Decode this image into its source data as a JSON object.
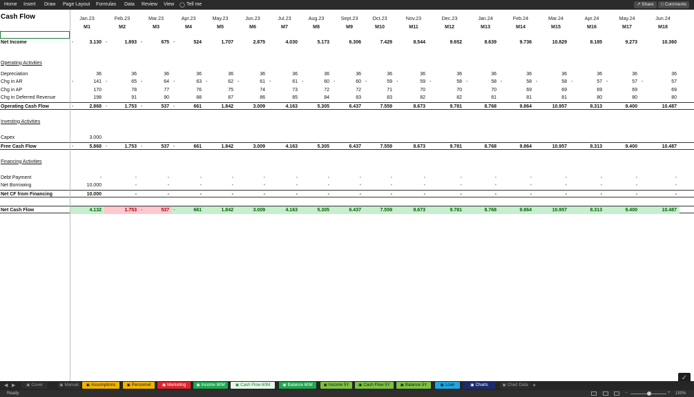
{
  "menubar": {
    "items": [
      "Home",
      "Insert",
      "Draw",
      "Page Layout",
      "Formulas",
      "Data",
      "Review",
      "View"
    ],
    "tell_me": "Tell me",
    "share": "Share",
    "comments": "Comments"
  },
  "sheet": {
    "title": "Cash Flow",
    "months": [
      "Jan.23",
      "Feb.23",
      "Mar.23",
      "Apr.23",
      "May.23",
      "Jun.23",
      "Jul.23",
      "Aug.23",
      "Sept.23",
      "Oct.23",
      "Nov.23",
      "Dec.23",
      "Jan.24",
      "Feb.24",
      "Mar.24",
      "Apr.24",
      "May.24",
      "Jun.24"
    ],
    "periods": [
      "M1",
      "M2",
      "M3",
      "M4",
      "M5",
      "M6",
      "M7",
      "M8",
      "M9",
      "M10",
      "M11",
      "M12",
      "M13",
      "M14",
      "M15",
      "M16",
      "M17",
      "M18"
    ],
    "rows": [
      {
        "label": "Net Income",
        "style": "bold",
        "lead_dash": "-",
        "cells": [
          {
            "v": "3.130",
            "n": true
          },
          {
            "v": "1.893",
            "n": true
          },
          {
            "v": "675",
            "n": true
          },
          {
            "v": "524"
          },
          {
            "v": "1.707"
          },
          {
            "v": "2.875"
          },
          {
            "v": "4.030"
          },
          {
            "v": "5.173"
          },
          {
            "v": "6.306"
          },
          {
            "v": "7.429"
          },
          {
            "v": "8.544"
          },
          {
            "v": "9.652"
          },
          {
            "v": "8.639"
          },
          {
            "v": "9.736"
          },
          {
            "v": "10.829"
          },
          {
            "v": "8.185"
          },
          {
            "v": "9.273"
          },
          {
            "v": "10.360"
          }
        ]
      },
      {
        "label": "Operating Activities",
        "style": "section",
        "cells": []
      },
      {
        "label": "Depreciation",
        "style": "",
        "cells": [
          {
            "v": "36"
          },
          {
            "v": "36"
          },
          {
            "v": "36"
          },
          {
            "v": "36"
          },
          {
            "v": "36"
          },
          {
            "v": "36"
          },
          {
            "v": "36"
          },
          {
            "v": "36"
          },
          {
            "v": "36"
          },
          {
            "v": "36"
          },
          {
            "v": "36"
          },
          {
            "v": "36"
          },
          {
            "v": "36"
          },
          {
            "v": "36"
          },
          {
            "v": "36"
          },
          {
            "v": "36"
          },
          {
            "v": "36"
          },
          {
            "v": "36"
          }
        ]
      },
      {
        "label": "Chg in AR",
        "style": "",
        "lead_dash": "-",
        "cells": [
          {
            "v": "141",
            "n": true
          },
          {
            "v": "65",
            "n": true
          },
          {
            "v": "64",
            "n": true
          },
          {
            "v": "63",
            "n": true
          },
          {
            "v": "62",
            "n": true
          },
          {
            "v": "61",
            "n": true
          },
          {
            "v": "61",
            "n": true
          },
          {
            "v": "60",
            "n": true
          },
          {
            "v": "60",
            "n": true
          },
          {
            "v": "59",
            "n": true
          },
          {
            "v": "59",
            "n": true
          },
          {
            "v": "58",
            "n": true
          },
          {
            "v": "58",
            "n": true
          },
          {
            "v": "58",
            "n": true
          },
          {
            "v": "58",
            "n": true
          },
          {
            "v": "57",
            "n": true
          },
          {
            "v": "57",
            "n": true
          },
          {
            "v": "57"
          }
        ]
      },
      {
        "label": "Chg in AP",
        "style": "",
        "cells": [
          {
            "v": "170"
          },
          {
            "v": "78"
          },
          {
            "v": "77"
          },
          {
            "v": "76"
          },
          {
            "v": "75"
          },
          {
            "v": "74"
          },
          {
            "v": "73"
          },
          {
            "v": "72"
          },
          {
            "v": "72"
          },
          {
            "v": "71"
          },
          {
            "v": "70"
          },
          {
            "v": "70"
          },
          {
            "v": "70"
          },
          {
            "v": "69"
          },
          {
            "v": "69"
          },
          {
            "v": "69"
          },
          {
            "v": "69"
          },
          {
            "v": "69"
          }
        ]
      },
      {
        "label": "Chg in Deferred Revenue",
        "style": "",
        "cells": [
          {
            "v": "198"
          },
          {
            "v": "91"
          },
          {
            "v": "90"
          },
          {
            "v": "88"
          },
          {
            "v": "87"
          },
          {
            "v": "86"
          },
          {
            "v": "85"
          },
          {
            "v": "84"
          },
          {
            "v": "83"
          },
          {
            "v": "83"
          },
          {
            "v": "82"
          },
          {
            "v": "82"
          },
          {
            "v": "81"
          },
          {
            "v": "81"
          },
          {
            "v": "81"
          },
          {
            "v": "80"
          },
          {
            "v": "80"
          },
          {
            "v": "80"
          }
        ]
      },
      {
        "label": "Operating Cash Flow",
        "style": "bold-border",
        "lead_dash": "-",
        "cells": [
          {
            "v": "2.868",
            "n": true
          },
          {
            "v": "1.753",
            "n": true
          },
          {
            "v": "537",
            "n": true
          },
          {
            "v": "661"
          },
          {
            "v": "1.842"
          },
          {
            "v": "3.009"
          },
          {
            "v": "4.163"
          },
          {
            "v": "5.305"
          },
          {
            "v": "6.437"
          },
          {
            "v": "7.559"
          },
          {
            "v": "8.673"
          },
          {
            "v": "9.781"
          },
          {
            "v": "8.768"
          },
          {
            "v": "9.864"
          },
          {
            "v": "10.957"
          },
          {
            "v": "8.313"
          },
          {
            "v": "9.400"
          },
          {
            "v": "10.487"
          }
        ]
      },
      {
        "label": "Investing Activities",
        "style": "section",
        "cells": []
      },
      {
        "label": "Capex",
        "style": "",
        "cells": [
          {
            "v": "3.000"
          }
        ]
      },
      {
        "label": "Free Cash Flow",
        "style": "bold-border",
        "lead_dash": "-",
        "cells": [
          {
            "v": "5.868",
            "n": true
          },
          {
            "v": "1.753",
            "n": true
          },
          {
            "v": "537",
            "n": true
          },
          {
            "v": "661"
          },
          {
            "v": "1.842"
          },
          {
            "v": "3.009"
          },
          {
            "v": "4.163"
          },
          {
            "v": "5.305"
          },
          {
            "v": "6.437"
          },
          {
            "v": "7.559"
          },
          {
            "v": "8.673"
          },
          {
            "v": "9.781"
          },
          {
            "v": "8.768"
          },
          {
            "v": "9.864"
          },
          {
            "v": "10.957"
          },
          {
            "v": "8.313"
          },
          {
            "v": "9.400"
          },
          {
            "v": "10.487"
          }
        ]
      },
      {
        "label": "Financing Activities",
        "style": "section",
        "cells": []
      },
      {
        "label": "Debt Payment",
        "style": "",
        "cells": [
          {
            "v": "-"
          },
          {
            "v": "-"
          },
          {
            "v": "-"
          },
          {
            "v": "-"
          },
          {
            "v": "-"
          },
          {
            "v": "-"
          },
          {
            "v": "-"
          },
          {
            "v": "-"
          },
          {
            "v": "-"
          },
          {
            "v": "-"
          },
          {
            "v": "-"
          },
          {
            "v": "-"
          },
          {
            "v": "-"
          },
          {
            "v": "-"
          },
          {
            "v": "-"
          },
          {
            "v": "-"
          },
          {
            "v": "-"
          },
          {
            "v": "-"
          }
        ]
      },
      {
        "label": "Net Borrowing",
        "style": "",
        "cells": [
          {
            "v": "10.000"
          },
          {
            "v": "-"
          },
          {
            "v": "-"
          },
          {
            "v": "-"
          },
          {
            "v": "-"
          },
          {
            "v": "-"
          },
          {
            "v": "-"
          },
          {
            "v": "-"
          },
          {
            "v": "-"
          },
          {
            "v": "-"
          },
          {
            "v": "-"
          },
          {
            "v": "-"
          },
          {
            "v": "-"
          },
          {
            "v": "-"
          },
          {
            "v": "-"
          },
          {
            "v": "-"
          },
          {
            "v": "-"
          },
          {
            "v": "-"
          }
        ]
      },
      {
        "label": "Net CF from Financing",
        "style": "bold-border",
        "cells": [
          {
            "v": "10.000"
          },
          {
            "v": "-"
          },
          {
            "v": "-"
          },
          {
            "v": "-"
          },
          {
            "v": "-"
          },
          {
            "v": "-"
          },
          {
            "v": "-"
          },
          {
            "v": "-"
          },
          {
            "v": "-"
          },
          {
            "v": "-"
          },
          {
            "v": "-"
          },
          {
            "v": "-"
          },
          {
            "v": "-"
          },
          {
            "v": "-"
          },
          {
            "v": "-"
          },
          {
            "v": "-"
          },
          {
            "v": "-"
          },
          {
            "v": "-"
          }
        ]
      },
      {
        "label": "Net Cash Flow",
        "style": "bold-border",
        "cells": [
          {
            "v": "4.132",
            "bg": "pos"
          },
          {
            "v": "1.753",
            "n": true,
            "bg": "neg"
          },
          {
            "v": "537",
            "n": true,
            "bg": "neg"
          },
          {
            "v": "661",
            "bg": "pos"
          },
          {
            "v": "1.842",
            "bg": "pos"
          },
          {
            "v": "3.009",
            "bg": "pos"
          },
          {
            "v": "4.163",
            "bg": "pos"
          },
          {
            "v": "5.305",
            "bg": "pos"
          },
          {
            "v": "6.437",
            "bg": "pos"
          },
          {
            "v": "7.559",
            "bg": "pos"
          },
          {
            "v": "8.673",
            "bg": "pos"
          },
          {
            "v": "9.781",
            "bg": "pos"
          },
          {
            "v": "8.768",
            "bg": "pos"
          },
          {
            "v": "9.864",
            "bg": "pos"
          },
          {
            "v": "10.957",
            "bg": "pos"
          },
          {
            "v": "8.313",
            "bg": "pos"
          },
          {
            "v": "9.400",
            "bg": "pos"
          },
          {
            "v": "10.487",
            "bg": "pos"
          }
        ]
      }
    ]
  },
  "colors": {
    "positive_fill": "#c6efce",
    "positive_text": "#006100",
    "negative_fill": "#ffc7ce",
    "negative_text": "#9c0006"
  },
  "tabs": [
    {
      "label": "Cover",
      "bg": "#2e2e2e",
      "fg": "#9a9a9a",
      "lock": true
    },
    {
      "label": "Manual",
      "bg": "#2e2e2e",
      "fg": "#9a9a9a",
      "lock": true
    },
    {
      "label": "Assumptions",
      "bg": "#f0b400",
      "fg": "#1a1a1a",
      "lock": true
    },
    {
      "label": "Personnel",
      "bg": "#f0b400",
      "fg": "#1a1a1a",
      "lock": true
    },
    {
      "label": "Marketing",
      "bg": "#e0242b",
      "fg": "#ffffff",
      "lock": true
    },
    {
      "label": "Income 60M",
      "bg": "#1fa84f",
      "fg": "#ffffff",
      "lock": true
    },
    {
      "label": "Cash Flow 60M",
      "bg": "#e8f5e9",
      "fg": "#1b7a3d",
      "lock": true,
      "active": true
    },
    {
      "label": "Balance 60M",
      "bg": "#1fa84f",
      "fg": "#ffffff",
      "lock": true
    },
    {
      "label": "Income 5Y",
      "bg": "#7cc242",
      "fg": "#1a1a1a",
      "lock": true
    },
    {
      "label": "Cash Flow 5Y",
      "bg": "#7cc242",
      "fg": "#1a1a1a",
      "lock": true
    },
    {
      "label": "Balance 5Y",
      "bg": "#7cc242",
      "fg": "#1a1a1a",
      "lock": true
    },
    {
      "label": "Loan",
      "bg": "#1ea7e1",
      "fg": "#1a1a1a",
      "lock": true
    },
    {
      "label": "Charts",
      "bg": "#1c2a6e",
      "fg": "#ffffff",
      "lock": true
    },
    {
      "label": "Chart Data",
      "bg": "#2e2e2e",
      "fg": "#9a9a9a",
      "lock": true
    }
  ],
  "status": {
    "ready": "Ready",
    "zoom": "150%"
  }
}
